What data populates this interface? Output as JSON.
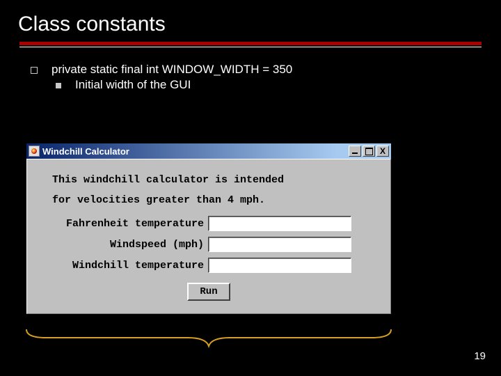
{
  "slide": {
    "title": "Class constants",
    "page_number": "19"
  },
  "bullets": {
    "main": "private static final int WINDOW_WIDTH = 350",
    "sub": "Initial width of the GUI"
  },
  "window": {
    "title": "Windchill Calculator",
    "intro_line1": "This windchill calculator is intended",
    "intro_line2": "for velocities greater than 4 mph.",
    "labels": {
      "fahrenheit": "Fahrenheit temperature",
      "windspeed": "Windspeed (mph)",
      "windchill": "Windchill temperature"
    },
    "run_button": "Run",
    "buttons": {
      "close_glyph": "X"
    }
  }
}
